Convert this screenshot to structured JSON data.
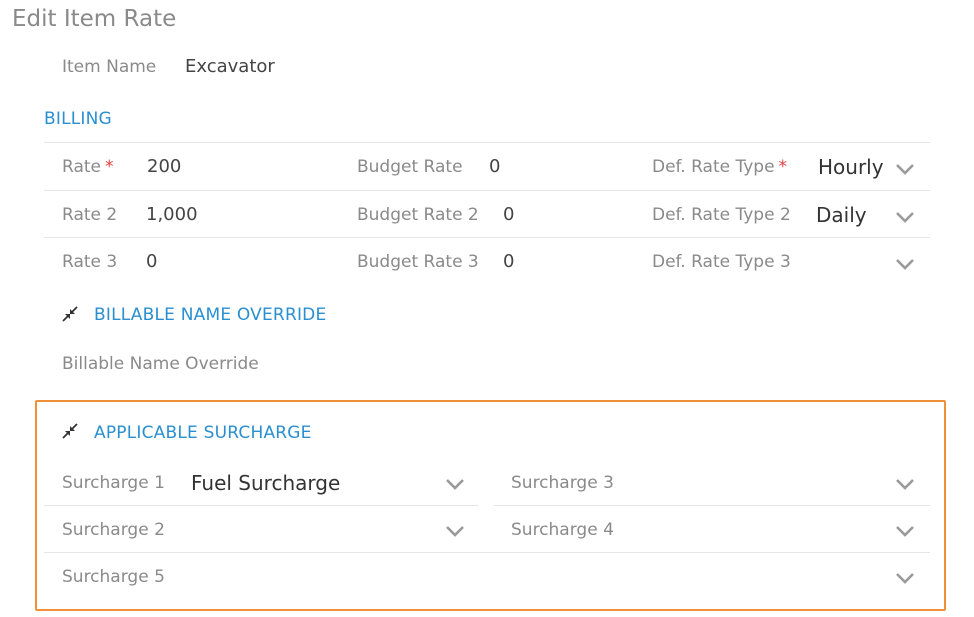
{
  "page": {
    "title": "Edit Item Rate"
  },
  "item": {
    "name_label": "Item Name",
    "name_value": "Excavator"
  },
  "billing": {
    "heading": "BILLING",
    "rows": [
      {
        "rate_label": "Rate",
        "rate_required": "*",
        "rate_value": "200",
        "budget_label": "Budget Rate",
        "budget_value": "0",
        "type_label": "Def. Rate Type",
        "type_required": "*",
        "type_value": "Hourly"
      },
      {
        "rate_label": "Rate 2",
        "rate_value": "1,000",
        "budget_label": "Budget Rate 2",
        "budget_value": "0",
        "type_label": "Def. Rate Type 2",
        "type_value": "Daily"
      },
      {
        "rate_label": "Rate 3",
        "rate_value": "0",
        "budget_label": "Budget Rate 3",
        "budget_value": "0",
        "type_label": "Def. Rate Type 3",
        "type_value": ""
      }
    ]
  },
  "billable_override": {
    "heading": "BILLABLE NAME OVERRIDE",
    "field_label": "Billable Name Override"
  },
  "surcharge": {
    "heading": "APPLICABLE SURCHARGE",
    "highlight_color": "#f0913a",
    "s1_label": "Surcharge 1",
    "s1_value": "Fuel Surcharge",
    "s2_label": "Surcharge 2",
    "s3_label": "Surcharge 3",
    "s4_label": "Surcharge 4",
    "s5_label": "Surcharge 5"
  },
  "icons": {
    "dropdown": "chevron-down-icon",
    "collapse": "collapse-arrows-icon"
  },
  "colors": {
    "accent": "#2a8fd0",
    "required": "#e04040"
  }
}
